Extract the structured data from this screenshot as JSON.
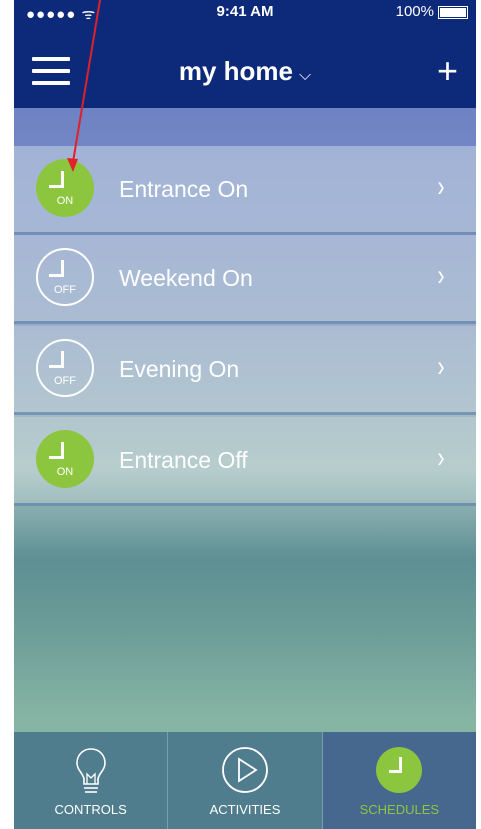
{
  "status": {
    "signal": "●●●●● ᯤ",
    "time": "9:41 AM",
    "battery": "100%"
  },
  "header": {
    "title": "my home",
    "title_chevron": "⌵",
    "add_label": "+"
  },
  "schedules": [
    {
      "label": "Entrance On",
      "state": "ON",
      "active": true
    },
    {
      "label": "Weekend On",
      "state": "OFF",
      "active": false
    },
    {
      "label": "Evening On",
      "state": "OFF",
      "active": false
    },
    {
      "label": "Entrance Off",
      "state": "ON",
      "active": true
    }
  ],
  "tabs": [
    {
      "label": "CONTROLS",
      "icon": "lightbulb-icon"
    },
    {
      "label": "ACTIVITIES",
      "icon": "play-icon"
    },
    {
      "label": "SCHEDULES",
      "icon": "clock-icon",
      "selected": true
    }
  ],
  "colors": {
    "navbar": "#0d2a7a",
    "accent": "#8cc63f",
    "annotation": "#e0202a"
  },
  "chevron_right": "›"
}
